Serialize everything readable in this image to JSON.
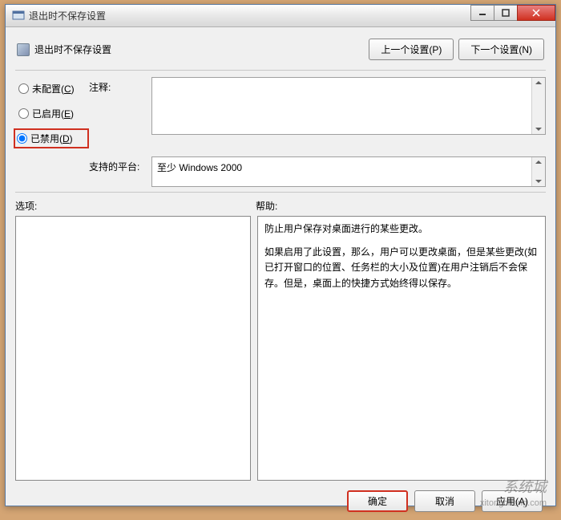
{
  "titlebar": {
    "title": "退出时不保存设置"
  },
  "header": {
    "title": "退出时不保存设置",
    "prev_button": "上一个设置(P)",
    "next_button": "下一个设置(N)"
  },
  "radios": {
    "not_configured": "未配置(C)",
    "enabled": "已启用(E)",
    "disabled": "已禁用(D)",
    "selected": "disabled"
  },
  "fields": {
    "comment_label": "注释:",
    "comment_value": "",
    "platform_label": "支持的平台:",
    "platform_value": "至少 Windows 2000"
  },
  "lower": {
    "options_label": "选项:",
    "help_label": "帮助:"
  },
  "help_text": {
    "p1": "防止用户保存对桌面进行的某些更改。",
    "p2": "如果启用了此设置，那么，用户可以更改桌面，但是某些更改(如已打开窗口的位置、任务栏的大小及位置)在用户注销后不会保存。但是，桌面上的快捷方式始终得以保存。"
  },
  "footer": {
    "ok": "确定",
    "cancel": "取消",
    "apply": "应用(A)"
  },
  "watermark": {
    "main": "系统城",
    "sub": "xitongcheng.com"
  }
}
